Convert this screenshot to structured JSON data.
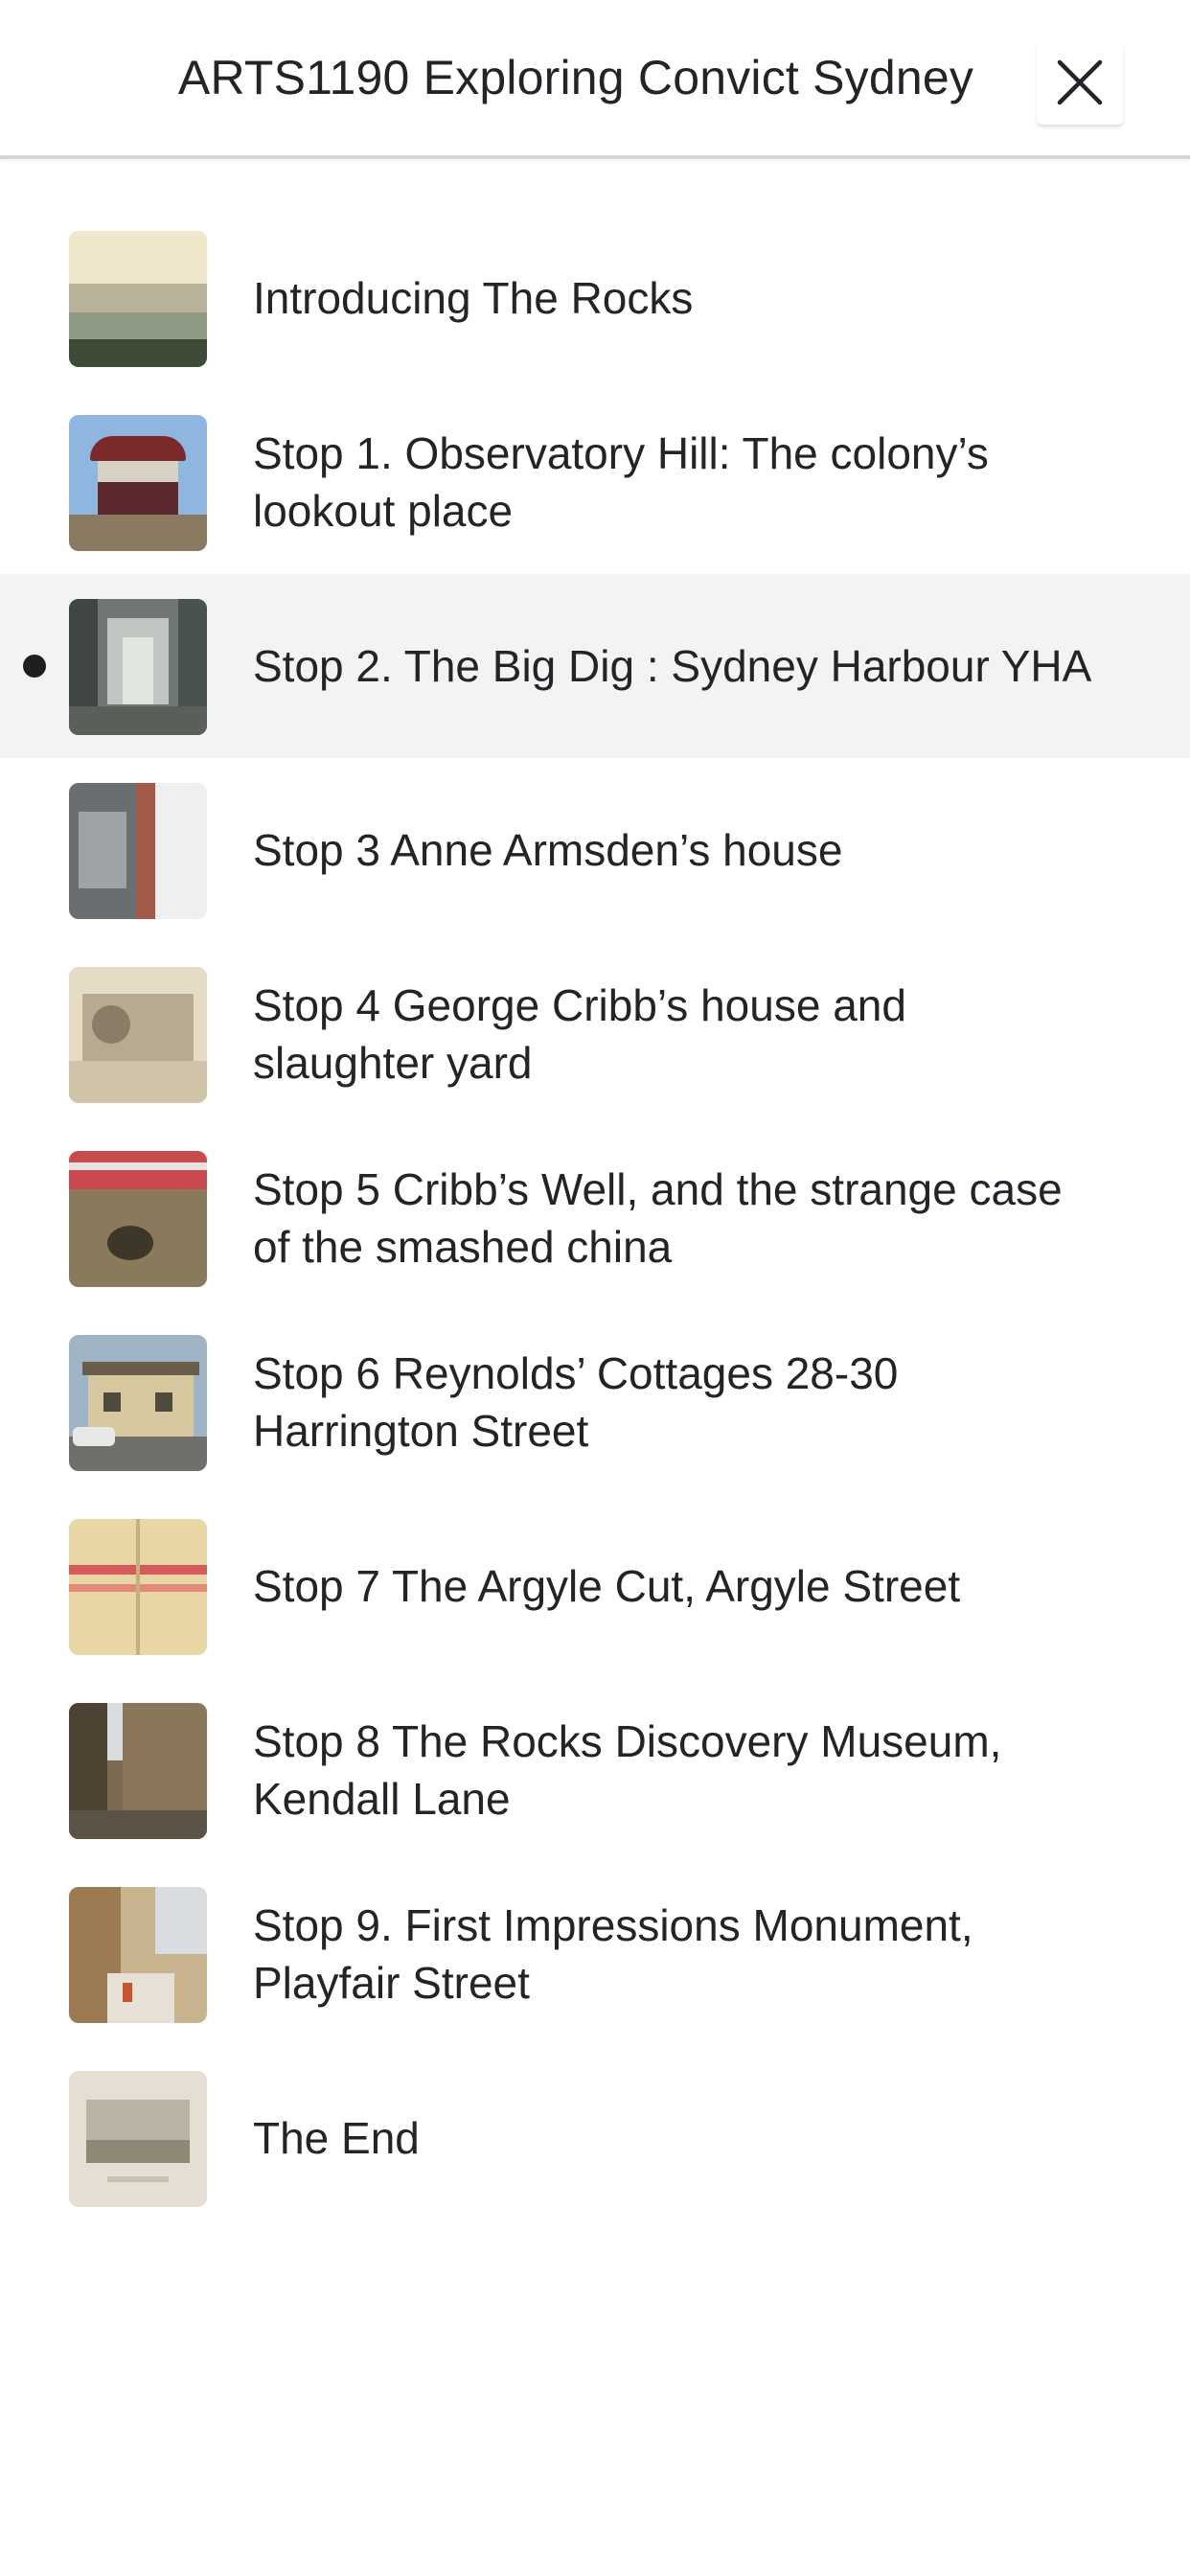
{
  "header": {
    "title": "ARTS1190 Exploring Convict Sydney",
    "close_icon": "close-icon"
  },
  "colors": {
    "active_row_bg": "#f3f3f4",
    "text": "#222428",
    "header_border": "#d4d4d4"
  },
  "tour": {
    "active_index": 2,
    "items": [
      {
        "label": "Introducing The Rocks",
        "thumb_icon": "harbour-painting-thumbnail"
      },
      {
        "label": "Stop 1. Observatory Hill: The colony’s lookout place",
        "thumb_icon": "rotunda-thumbnail"
      },
      {
        "label": "Stop 2. The Big Dig : Sydney Harbour YHA",
        "thumb_icon": "hostel-interior-thumbnail"
      },
      {
        "label": "Stop 3 Anne Armsden’s house",
        "thumb_icon": "building-glass-thumbnail"
      },
      {
        "label": "Stop 4 George Cribb’s house and slaughter yard",
        "thumb_icon": "old-sketch-thumbnail"
      },
      {
        "label": "Stop 5 Cribb’s Well, and the strange case of the smashed china",
        "thumb_icon": "excavated-well-thumbnail"
      },
      {
        "label": "Stop 6 Reynolds’ Cottages 28-30 Harrington Street",
        "thumb_icon": "cottages-thumbnail"
      },
      {
        "label": "Stop 7 The Argyle Cut, Argyle Street",
        "thumb_icon": "old-map-thumbnail"
      },
      {
        "label": "Stop 8 The Rocks Discovery Museum, Kendall Lane",
        "thumb_icon": "laneway-thumbnail"
      },
      {
        "label": "Stop 9. First Impressions Monument, Playfair Street",
        "thumb_icon": "monument-thumbnail"
      },
      {
        "label": "The End",
        "thumb_icon": "engraving-thumbnail"
      }
    ]
  }
}
